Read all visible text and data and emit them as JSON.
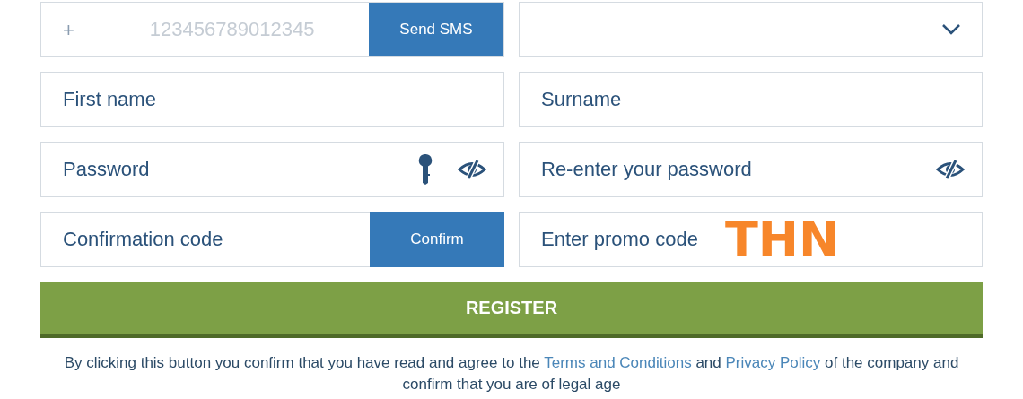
{
  "phone": {
    "prefix": "+",
    "placeholder": "123456789012345",
    "button": "Send SMS"
  },
  "fields": [
    {
      "kind": "text",
      "placeholder": "First name"
    },
    {
      "kind": "text",
      "placeholder": "Surname"
    },
    {
      "kind": "password",
      "placeholder": "Password",
      "key_icon": true
    },
    {
      "kind": "password",
      "placeholder": "Re-enter your password",
      "key_icon": false
    },
    {
      "kind": "code",
      "placeholder": "Confirmation code"
    },
    {
      "kind": "promo",
      "placeholder": "Enter promo code",
      "overlay": "THN"
    }
  ],
  "confirm_button": "Confirm",
  "register_button": "REGISTER",
  "legal": [
    {
      "kind": "text",
      "text": "By clicking this button you confirm that you have read and agree to the"
    },
    {
      "kind": "link",
      "text": "Terms and Conditions"
    },
    {
      "kind": "text",
      "text": "and"
    },
    {
      "kind": "link",
      "text": "Privacy Policy"
    },
    {
      "kind": "text",
      "text": "of the company and confirm that you are of legal age"
    }
  ]
}
